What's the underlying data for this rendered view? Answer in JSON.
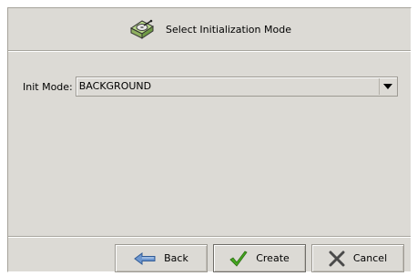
{
  "window": {
    "title": "Select Initialization Mode",
    "icon": "disk-drive-icon"
  },
  "form": {
    "init_mode_label": "Init Mode:",
    "init_mode_value": "BACKGROUND",
    "dropdown_icon": "triangle-down-icon"
  },
  "buttons": {
    "back": {
      "label": "Back",
      "icon": "arrow-left-icon"
    },
    "create": {
      "label": "Create",
      "icon": "checkmark-icon"
    },
    "cancel": {
      "label": "Cancel",
      "icon": "x-icon"
    }
  },
  "colors": {
    "background": "#dcdad5",
    "check": "#3a9a1a",
    "cancel_x": "#4a4a4a",
    "arrow": "#3d6fb3"
  }
}
